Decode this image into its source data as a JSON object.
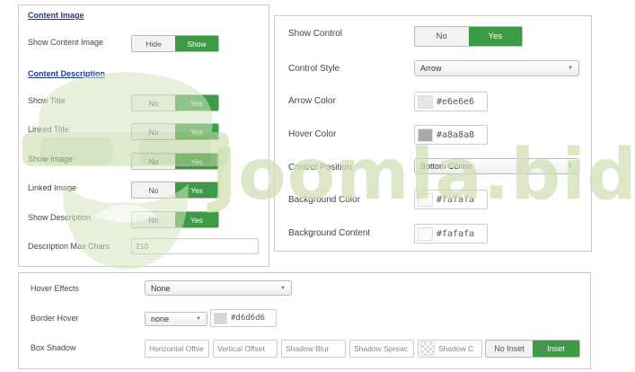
{
  "left_panel": {
    "content_image_title": "Content Image",
    "show_content_image_label": "Show Content Image",
    "show_content_image_toggle": {
      "off": "Hide",
      "on": "Show"
    },
    "content_description_title": "Content Description",
    "rows": [
      {
        "label": "Show Title",
        "off": "No",
        "on": "Yes"
      },
      {
        "label": "Linked Title",
        "off": "No",
        "on": "Yes"
      },
      {
        "label": "Show Image",
        "off": "No",
        "on": "Yes"
      },
      {
        "label": "Linked Image",
        "off": "No",
        "on": "Yes"
      },
      {
        "label": "Show Description",
        "off": "No",
        "on": "Yes"
      }
    ],
    "desc_max_chars_label": "Description Max Chars",
    "desc_max_chars_value": "210"
  },
  "right_panel": {
    "show_control_label": "Show Control",
    "show_control_toggle": {
      "off": "No",
      "on": "Yes"
    },
    "control_style_label": "Control Style",
    "control_style_value": "Arrow",
    "arrow_color_label": "Arrow Color",
    "arrow_color_value": "#e6e6e6",
    "hover_color_label": "Hover Color",
    "hover_color_value": "#a8a8a8",
    "control_position_label": "Control Position",
    "control_position_value": "Bottom Center",
    "background_color_label": "Background Color",
    "background_color_value": "#fafafa",
    "background_content_label": "Background Content",
    "background_content_value": "#fafafa"
  },
  "bottom_panel": {
    "hover_effects_label": "Hover Effects",
    "hover_effects_value": "None",
    "border_hover_label": "Border Hover",
    "border_hover_value": "none",
    "border_hover_color": "#d6d6d6",
    "box_shadow_label": "Box Shadow",
    "shadow_fields": {
      "horizontal": "Horizontal Offse",
      "vertical": "Vertical Offset",
      "blur": "Shadow Blur",
      "spread": "Shadow Spreac",
      "color": "Shadow C"
    },
    "inset_toggle": {
      "off": "No Inset",
      "on": "Inset"
    }
  },
  "watermark": {
    "text": "Joomla.bid"
  },
  "colors": {
    "accent_green": "#3e9b45",
    "title_blue": "#1a3d8f"
  }
}
